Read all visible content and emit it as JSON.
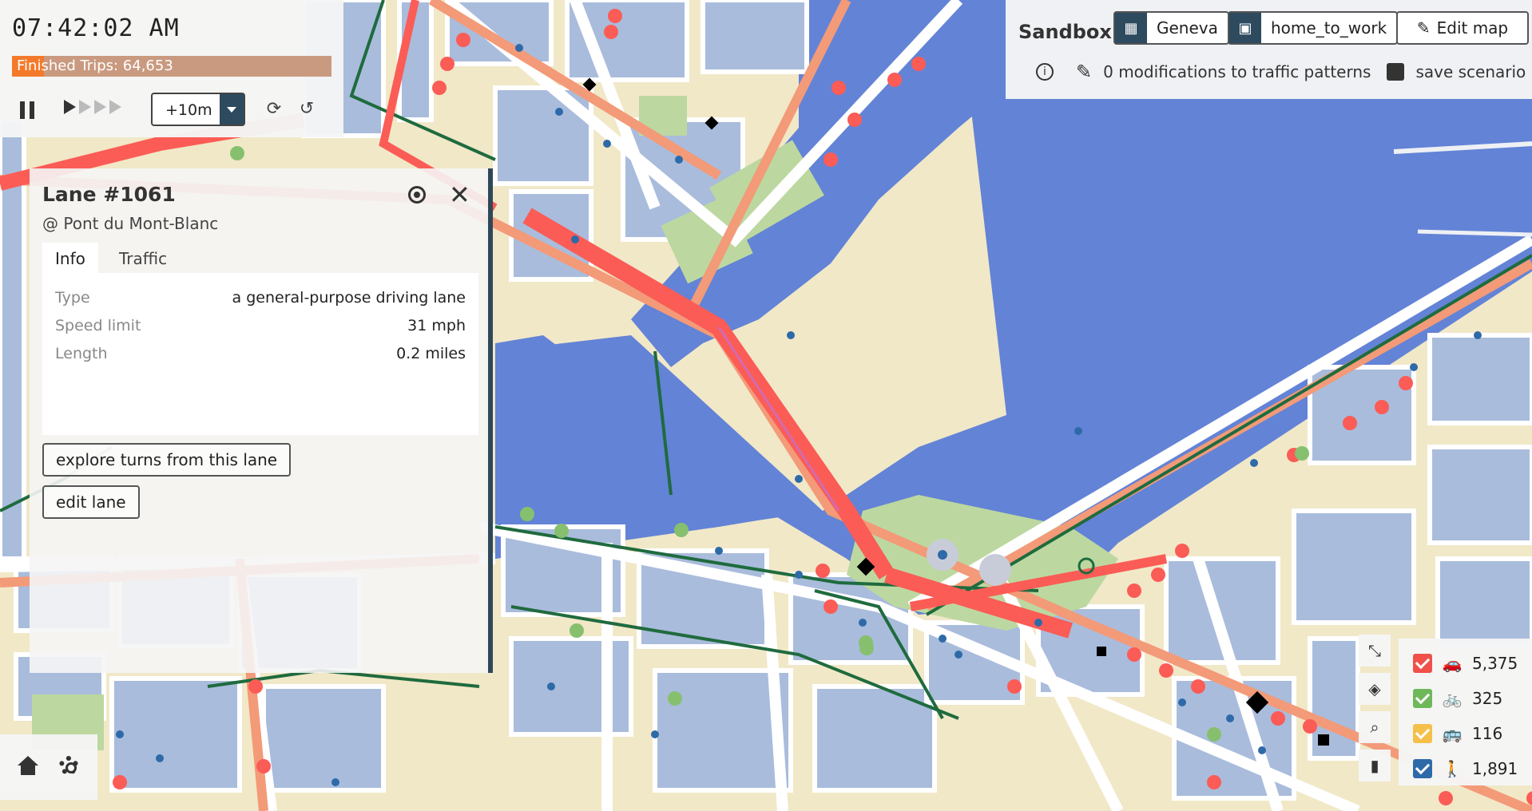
{
  "time_panel": {
    "clock": "07:42:02 AM",
    "finished_trips": "Finished Trips: 64,653",
    "trips_progress": 0.1,
    "step_value": "+10m"
  },
  "sandbox": {
    "title": "Sandbox",
    "map_name": "Geneva",
    "scenario_name": "home_to_work",
    "edit_map_label": "Edit map",
    "modifications_text": "0 modifications to traffic patterns",
    "save_label": "save scenario"
  },
  "lane_panel": {
    "title": "Lane #1061",
    "subtitle": "@ Pont du Mont-Blanc",
    "tabs": [
      "Info",
      "Traffic"
    ],
    "rows": [
      {
        "key": "Type",
        "value": "a general-purpose driving lane"
      },
      {
        "key": "Speed limit",
        "value": "31 mph"
      },
      {
        "key": "Length",
        "value": "0.2 miles"
      }
    ],
    "explore_label": "explore turns from this lane",
    "edit_label": "edit lane"
  },
  "legend": {
    "items": [
      {
        "icon": "car-icon",
        "glyph": "🚗",
        "count": "5,375",
        "color": "#f0504a"
      },
      {
        "icon": "bike-icon",
        "glyph": "🚲",
        "count": "325",
        "color": "#6eb85a"
      },
      {
        "icon": "bus-icon",
        "glyph": "🚌",
        "count": "116",
        "color": "#f5c04a"
      },
      {
        "icon": "pedestrian-icon",
        "glyph": "🚶",
        "count": "1,891",
        "color": "#2e6aa8"
      }
    ]
  },
  "colors": {
    "water": "#6383d6",
    "land": "#f1e8c8",
    "building": "#a9bcdc",
    "road": "#ffffff",
    "arterial": "#f39a78",
    "car_dot": "#fb5c56",
    "bike_lane": "#1f6b3e",
    "park": "#bcd8a0",
    "panel_accent": "#2e4a5e"
  }
}
